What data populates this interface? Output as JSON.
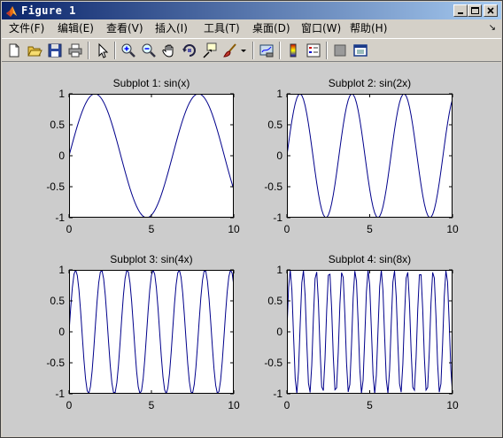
{
  "window": {
    "title": "Figure 1"
  },
  "menubar": {
    "items": [
      {
        "label": "文件(F)"
      },
      {
        "label": "编辑(E)"
      },
      {
        "label": "查看(V)"
      },
      {
        "label": "插入(I)"
      },
      {
        "label": "工具(T)"
      },
      {
        "label": "桌面(D)"
      },
      {
        "label": "窗口(W)"
      },
      {
        "label": "帮助(H)"
      }
    ],
    "dock_arrow": "↘"
  },
  "toolbar": {
    "icons": [
      "new-figure-icon",
      "open-file-icon",
      "save-icon",
      "print-icon",
      "select-arrow-icon",
      "zoom-in-icon",
      "zoom-out-icon",
      "pan-hand-icon",
      "rotate-3d-icon",
      "data-cursor-icon",
      "brush-icon",
      "brush-dropdown-icon",
      "link-plot-icon",
      "colorbar-icon",
      "legend-icon",
      "hide-plot-tools-icon",
      "show-plot-tools-icon"
    ]
  },
  "colors": {
    "line": "#00008b",
    "figure_background": "#cccccc",
    "axes_background": "#ffffff"
  },
  "chart_data": [
    {
      "type": "line",
      "title": "Subplot 1: sin(x)",
      "function": "sin(1x)",
      "frequency": 1,
      "xlim": [
        0,
        10
      ],
      "ylim": [
        -1,
        1
      ],
      "xticks": [
        "0",
        "5",
        "10"
      ],
      "yticks": [
        "1",
        "0.5",
        "0",
        "-0.5",
        "-1"
      ],
      "x_start": 0,
      "x_end": 10,
      "x_step": 0.1
    },
    {
      "type": "line",
      "title": "Subplot 2: sin(2x)",
      "function": "sin(2x)",
      "frequency": 2,
      "xlim": [
        0,
        10
      ],
      "ylim": [
        -1,
        1
      ],
      "xticks": [
        "0",
        "5",
        "10"
      ],
      "yticks": [
        "1",
        "0.5",
        "0",
        "-0.5",
        "-1"
      ],
      "x_start": 0,
      "x_end": 10,
      "x_step": 0.1
    },
    {
      "type": "line",
      "title": "Subplot 3: sin(4x)",
      "function": "sin(4x)",
      "frequency": 4,
      "xlim": [
        0,
        10
      ],
      "ylim": [
        -1,
        1
      ],
      "xticks": [
        "0",
        "5",
        "10"
      ],
      "yticks": [
        "1",
        "0.5",
        "0",
        "-0.5",
        "-1"
      ],
      "x_start": 0,
      "x_end": 10,
      "x_step": 0.1
    },
    {
      "type": "line",
      "title": "Subplot 4: sin(8x)",
      "function": "sin(8x)",
      "frequency": 8,
      "xlim": [
        0,
        10
      ],
      "ylim": [
        -1,
        1
      ],
      "xticks": [
        "0",
        "5",
        "10"
      ],
      "yticks": [
        "1",
        "0.5",
        "0",
        "-0.5",
        "-1"
      ],
      "x_start": 0,
      "x_end": 10,
      "x_step": 0.1
    }
  ]
}
